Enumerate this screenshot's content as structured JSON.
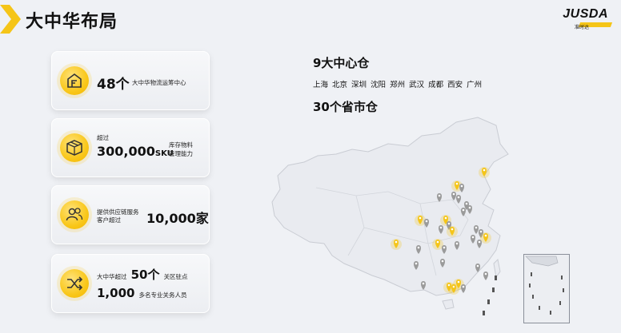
{
  "page": {
    "title": "大中华布局"
  },
  "logo": {
    "text": "JUSDA",
    "sub": "准时达"
  },
  "cards": [
    {
      "icon": "warehouse-icon",
      "number": "48个",
      "desc": "大中华物流运筹中心"
    },
    {
      "icon": "package-box-icon",
      "prefix": "超过",
      "number": "300,000",
      "unit": "SKU",
      "desc_line1": "库存物料",
      "desc_line2": "管理能力"
    },
    {
      "icon": "users-group-icon",
      "desc_line1": "提供供应链服务",
      "desc_line2": "客户超过",
      "number": "10,000家"
    },
    {
      "icon": "customs-shuffle-icon",
      "line1_prefix": "大中华超过",
      "line1_number": "50个",
      "line1_suffix": "关区驻点",
      "line2_number": "1,000",
      "line2_suffix": "多名专业关务人员"
    }
  ],
  "map": {
    "hub_title": "9大中心仓",
    "hub_cities": "上海  北京  深圳  沈阳  郑州  武汉  成都  西安  广州",
    "province_title": "30个省市仓",
    "colors": {
      "hub_pin": "#f5c518",
      "province_pin": "#9a9a9a"
    }
  }
}
